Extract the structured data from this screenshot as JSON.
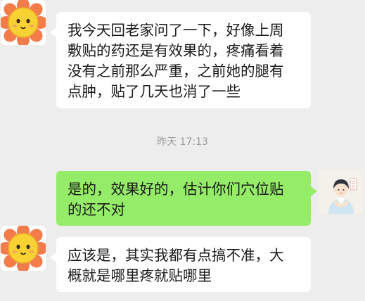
{
  "messages": [
    {
      "sender": "contact",
      "avatar_icon": "sunflower-avatar-icon",
      "text": "我今天回老家问了一下，好像上周\n敷贴的药还是有效果的，疼痛看着\n没有之前那么严重，之前她的腿有\n点肿，贴了几天也消了一些"
    },
    {
      "sender": "self",
      "avatar_icon": "doctor-avatar-icon",
      "text": "是的，效果好的，估计你们穴位贴\n的还不对"
    },
    {
      "sender": "contact",
      "avatar_icon": "sunflower-avatar-icon",
      "text": "应该是，其实我都有点搞不准，大\n概就是哪里疼就贴哪里"
    }
  ],
  "timestamp": "昨天 17:13",
  "colors": {
    "background": "#ededed",
    "incoming_bubble": "#ffffff",
    "outgoing_bubble": "#95ec69"
  }
}
